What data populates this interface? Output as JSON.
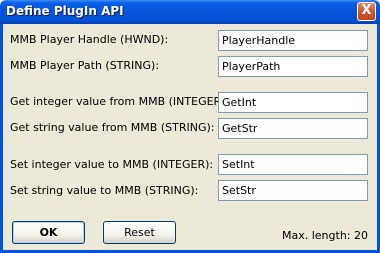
{
  "window": {
    "title": "Define PlugIn API",
    "close_glyph": "X"
  },
  "fields": [
    {
      "label": "MMB Player Handle (HWND):",
      "value": "PlayerHandle"
    },
    {
      "label": "MMB Player Path (STRING):",
      "value": "PlayerPath"
    },
    {
      "label": "Get integer value from MMB (INTEGER):",
      "value": "GetInt"
    },
    {
      "label": "Get string value from MMB (STRING):",
      "value": "GetStr"
    },
    {
      "label": "Set integer value to MMB (INTEGER):",
      "value": "SetInt"
    },
    {
      "label": "Set string value to MMB (STRING):",
      "value": "SetStr"
    }
  ],
  "buttons": {
    "ok": "OK",
    "reset": "Reset"
  },
  "footer": {
    "max_length": "Max. length: 20"
  },
  "icons": {
    "close": "close-icon"
  },
  "colors": {
    "titlebar": "#0553d8",
    "client": "#ece9d8",
    "field_border": "#7f9db9"
  }
}
